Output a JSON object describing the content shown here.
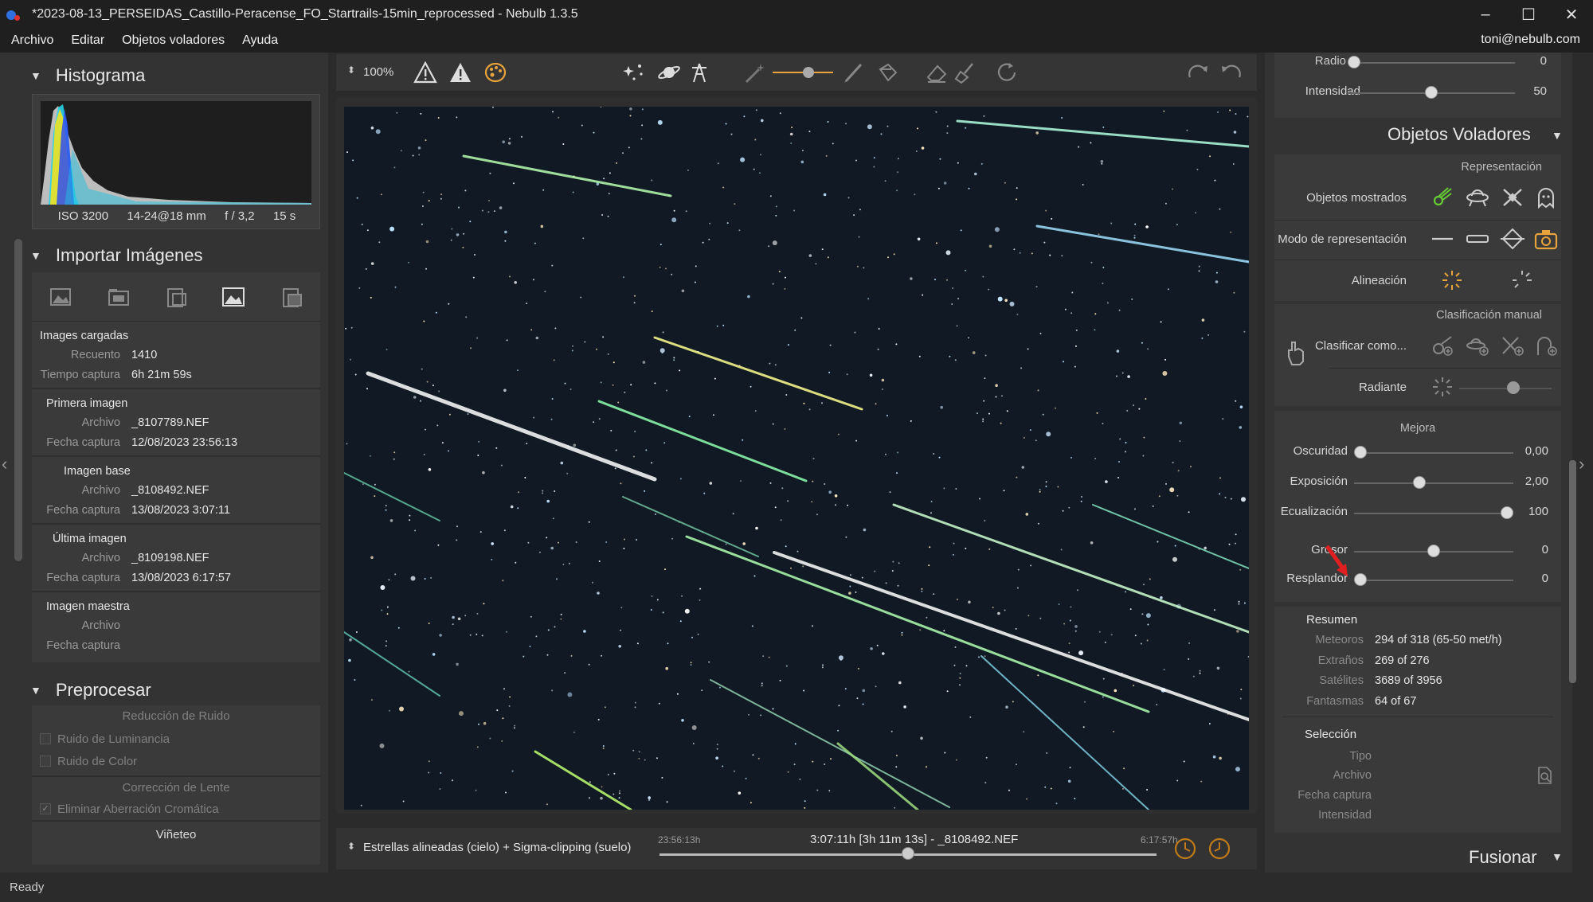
{
  "window": {
    "title": "*2023-08-13_PERSEIDAS_Castillo-Peracense_FO_Startrails-15min_reprocessed - Nebulb 1.3.5",
    "controls": [
      "–",
      "☐",
      "✕"
    ]
  },
  "menu": {
    "items": [
      "Archivo",
      "Editar",
      "Objetos voladores",
      "Ayuda"
    ],
    "user": "toni@nebulb.com"
  },
  "left": {
    "histogram": {
      "title": "Histograma",
      "iso": "ISO 3200",
      "lens": "14-24@18 mm",
      "aperture": "f / 3,2",
      "exposure": "15 s"
    },
    "import": {
      "title": "Importar Imágenes",
      "loaded": {
        "header": "Images cargadas",
        "count_label": "Recuento",
        "count": "1410",
        "time_label": "Tiempo captura",
        "time": "6h 21m 59s"
      },
      "first": {
        "header": "Primera imagen",
        "file_label": "Archivo",
        "file": "_8107789.NEF",
        "date_label": "Fecha captura",
        "date": "12/08/2023 23:56:13"
      },
      "base": {
        "header": "Imagen base",
        "file_label": "Archivo",
        "file": "_8108492.NEF",
        "date_label": "Fecha captura",
        "date": "13/08/2023 3:07:11"
      },
      "last": {
        "header": "Última imagen",
        "file_label": "Archivo",
        "file": "_8109198.NEF",
        "date_label": "Fecha captura",
        "date": "13/08/2023 6:17:57"
      },
      "master": {
        "header": "Imagen maestra",
        "file_label": "Archivo",
        "date_label": "Fecha captura"
      }
    },
    "preprocess": {
      "title": "Preprocesar",
      "noise_header": "Reducción de Ruido",
      "luminance": "Ruido de Luminancia",
      "color": "Ruido de Color",
      "lens_header": "Corrección de Lente",
      "chromatic": "Eliminar Aberración Cromática",
      "vignette": "Viñeteo"
    }
  },
  "toolbar": {
    "zoom": "100%"
  },
  "bottom": {
    "mode": "Estrellas alineadas (cielo) + Sigma-clipping (suelo)",
    "start_time": "23:56:13h",
    "current": "3:07:11h [3h 11m 13s] - _8108492.NEF",
    "end_time": "6:17:57h",
    "timeline_position": 0.5
  },
  "right": {
    "top_sliders": [
      {
        "label": "Radio",
        "value": "0",
        "pos": 0.0
      },
      {
        "label": "Intensidad",
        "value": "50",
        "pos": 0.5
      }
    ],
    "flying_objects": {
      "title": "Objetos Voladores",
      "representation_header": "Representación",
      "shown_label": "Objetos mostrados",
      "mode_label": "Modo de representación",
      "alignment_label": "Alineación",
      "manual_header": "Clasificación manual",
      "classify_label": "Clasificar como...",
      "radiant_label": "Radiante",
      "radiant_pos": 0.6,
      "improve_header": "Mejora",
      "sliders": [
        {
          "label": "Oscuridad",
          "value": "0,00",
          "pos": 0.0
        },
        {
          "label": "Exposición",
          "value": "2,00",
          "pos": 0.4
        },
        {
          "label": "Ecualización",
          "value": "100",
          "pos": 1.0
        },
        {
          "label": "Grosor",
          "value": "0",
          "pos": 0.5
        },
        {
          "label": "Resplandor",
          "value": "0",
          "pos": 0.0
        }
      ],
      "summary_header": "Resumen",
      "summary": [
        {
          "k": "Meteoros",
          "v": "294 of 318 (65-50 met/h)"
        },
        {
          "k": "Extraños",
          "v": "269 of 276"
        },
        {
          "k": "Satélites",
          "v": "3689 of 3956"
        },
        {
          "k": "Fantasmas",
          "v": "64 of 67"
        }
      ],
      "selection_header": "Selección",
      "selection": [
        "Tipo",
        "Archivo",
        "Fecha captura",
        "Intensidad"
      ]
    },
    "merge_title": "Fusionar"
  },
  "status": "Ready",
  "colors": {
    "accent_orange": "#e8a33a",
    "accent_green": "#66cc33",
    "arrow_red": "#e02020"
  }
}
